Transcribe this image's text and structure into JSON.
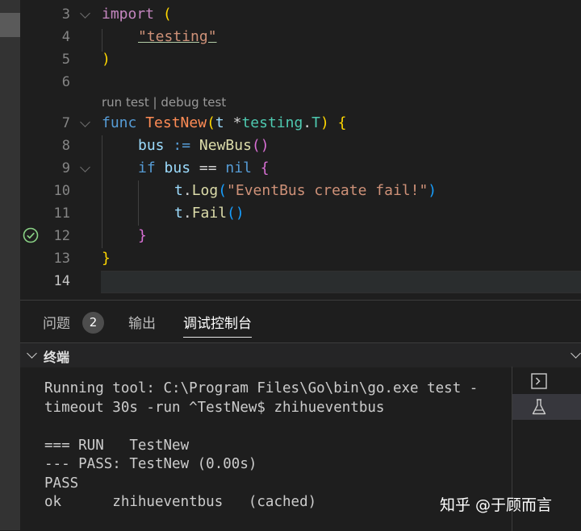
{
  "editor": {
    "codelens": {
      "run": "run test",
      "separator": " | ",
      "debug": "debug test"
    },
    "lines": [
      {
        "n": "3"
      },
      {
        "n": "4"
      },
      {
        "n": "5"
      },
      {
        "n": "6"
      },
      {
        "n": "7"
      },
      {
        "n": "8"
      },
      {
        "n": "9"
      },
      {
        "n": "10"
      },
      {
        "n": "11"
      },
      {
        "n": "12"
      },
      {
        "n": "13"
      },
      {
        "n": "14"
      }
    ],
    "tokens": {
      "import": "import",
      "lparen": "(",
      "testing_str": "\"testing\"",
      "rparen": ")",
      "func": "func",
      "testnew": "TestNew",
      "t": "t",
      "ptr": "*",
      "testing": "testing",
      "dot": ".",
      "T": "T",
      "lbrace": "{",
      "bus": "bus",
      "assign": ":=",
      "newbus": "NewBus",
      "call": "()",
      "if": "if",
      "eq": "==",
      "nil": "nil",
      "log": "Log",
      "msg": "\"EventBus create fail!\"",
      "fail": "Fail",
      "rbrace": "}"
    }
  },
  "panel": {
    "tabs": [
      {
        "label": "问题",
        "badge": "2"
      },
      {
        "label": "输出"
      },
      {
        "label": "调试控制台"
      }
    ],
    "terminal_title": "终端",
    "terminal_lines": [
      "Running tool: C:\\Program Files\\Go\\bin\\go.exe test -",
      "timeout 30s -run ^TestNew$ zhihueventbus",
      "",
      "=== RUN   TestNew",
      "--- PASS: TestNew (0.00s)",
      "PASS",
      "ok      zhihueventbus   (cached)"
    ]
  },
  "watermark": "知乎 @于顾而言",
  "colors": {
    "background": "#1e1e1e",
    "pass_icon": "#89d185",
    "keyword": "#c586c0",
    "function": "#dcdcaa",
    "string": "#ce9178"
  },
  "icons": {
    "pass": "check-circle-icon",
    "terminal": "terminal-icon",
    "test": "beaker-icon"
  }
}
